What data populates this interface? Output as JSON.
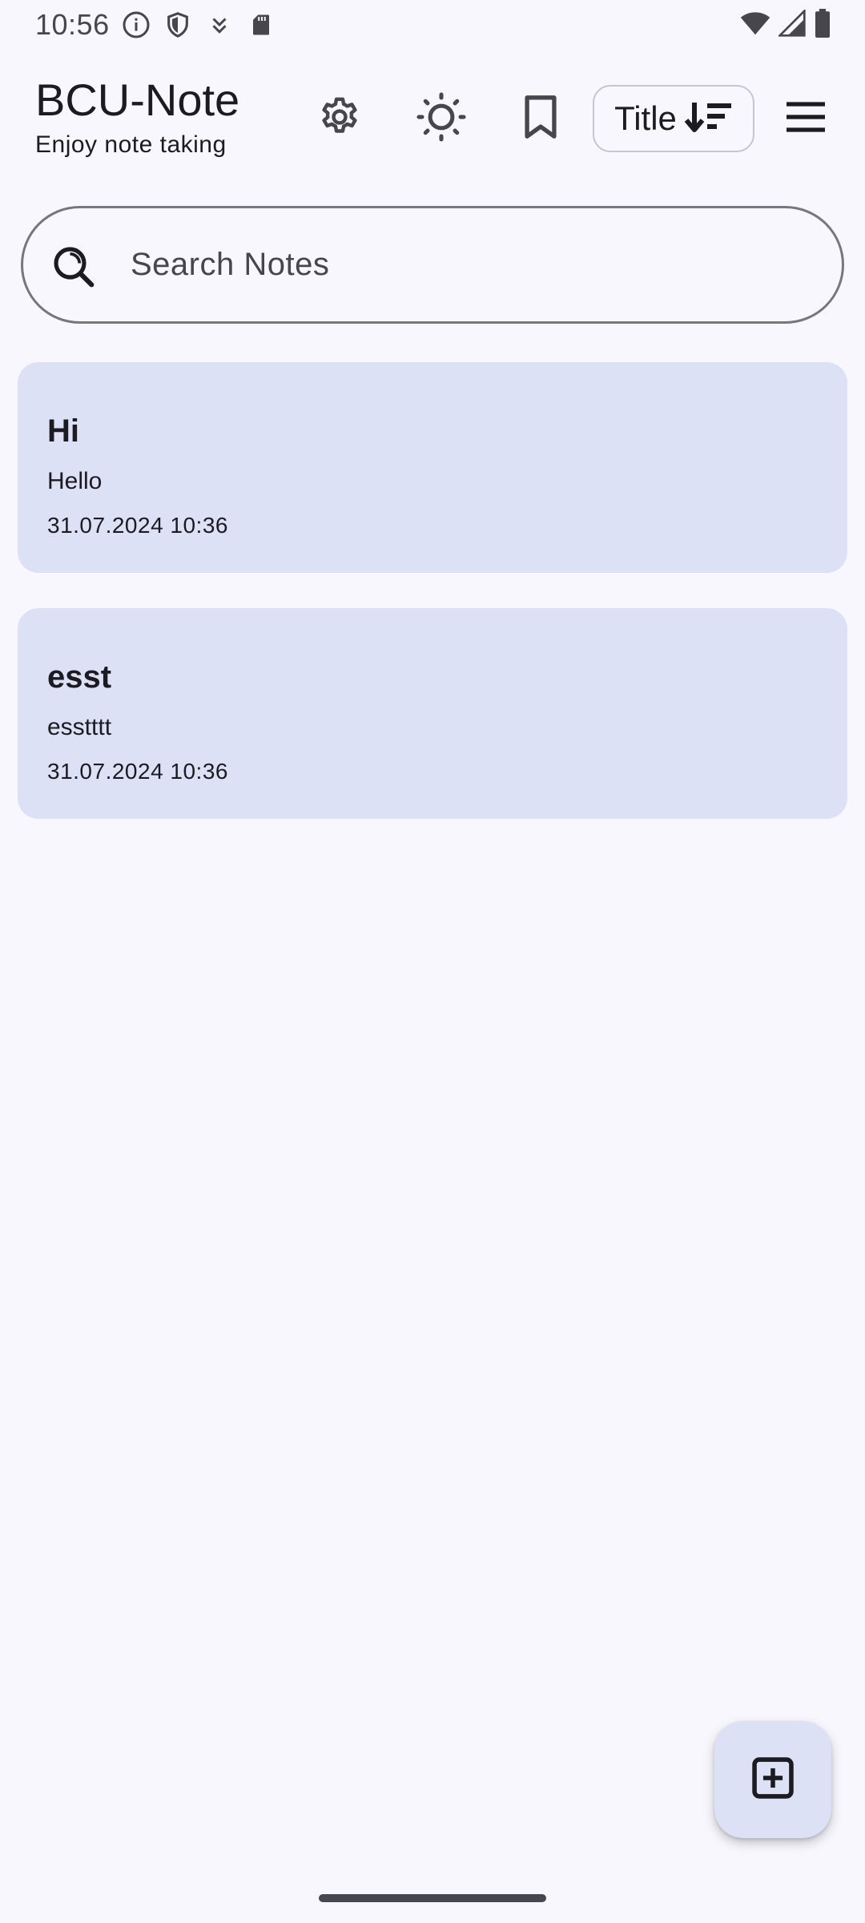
{
  "status_bar": {
    "time": "10:56",
    "left_icons": [
      "info-icon",
      "shield-icon",
      "download-icon",
      "sd-card-icon"
    ],
    "right_icons": [
      "wifi-icon",
      "signal-icon",
      "battery-icon"
    ]
  },
  "app_bar": {
    "title": "BCU-Note",
    "subtitle": "Enjoy note taking",
    "actions": [
      "settings-icon",
      "theme-icon",
      "bookmark-icon"
    ],
    "sort": {
      "label": "Title",
      "icon": "sort-descending-icon"
    },
    "menu_icon": "hamburger-menu-icon"
  },
  "search": {
    "placeholder": "Search Notes",
    "value": ""
  },
  "notes": [
    {
      "title": "Hi",
      "body": "Hello",
      "date": "31.07.2024 10:36"
    },
    {
      "title": "esst",
      "body": "esstttt",
      "date": "31.07.2024 10:36"
    }
  ],
  "fab": {
    "icon": "add-note-icon"
  },
  "colors": {
    "background": "#f8f7fd",
    "card": "#dde1f6",
    "text": "#1b1b21",
    "outline": "#76767e"
  }
}
